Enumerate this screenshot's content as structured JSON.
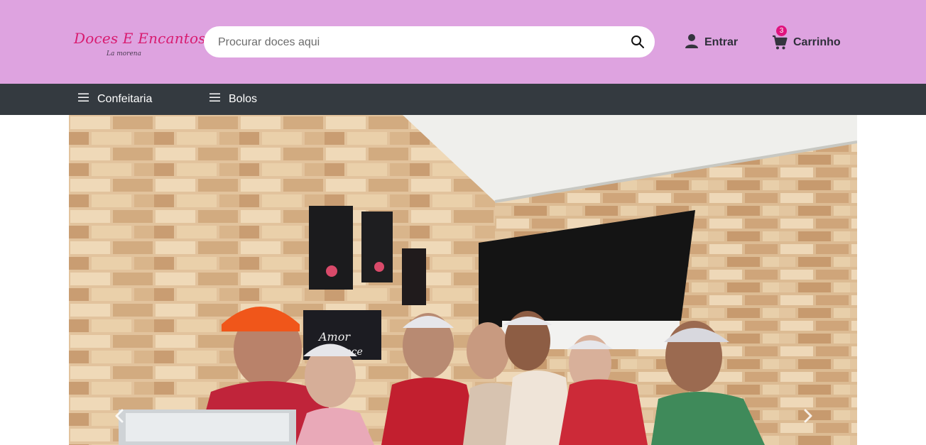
{
  "header": {
    "logo": {
      "name": "Doces E Encantos",
      "tagline": "La morena"
    },
    "search": {
      "placeholder": "Procurar doces aqui",
      "value": "",
      "button_icon": "search-icon"
    },
    "login": {
      "label": "Entrar",
      "icon": "user-icon"
    },
    "cart": {
      "label": "Carrinho",
      "icon": "cart-icon",
      "count": "3"
    }
  },
  "nav": {
    "items": [
      {
        "label": "Confeitaria",
        "icon": "menu-icon"
      },
      {
        "label": "Bolos",
        "icon": "menu-icon"
      }
    ]
  },
  "carousel": {
    "prev_icon": "chevron-left-icon",
    "next_icon": "chevron-right-icon",
    "sign_lines": [
      "Amor",
      "Doce"
    ]
  },
  "colors": {
    "header_bg": "#dea3e0",
    "nav_bg": "#343a40",
    "logo_pink": "#d81b6f",
    "badge": "#e0137e"
  }
}
